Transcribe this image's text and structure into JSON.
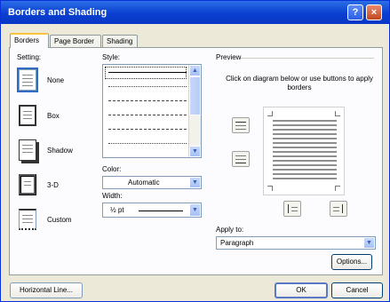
{
  "window": {
    "title": "Borders and Shading",
    "help_label": "?",
    "close_label": "×"
  },
  "tabs": [
    {
      "label": "Borders",
      "active": true
    },
    {
      "label": "Page Border",
      "active": false
    },
    {
      "label": "Shading",
      "active": false
    }
  ],
  "setting": {
    "label": "Setting:",
    "items": [
      {
        "label": "None",
        "selected": true
      },
      {
        "label": "Box",
        "selected": false
      },
      {
        "label": "Shadow",
        "selected": false
      },
      {
        "label": "3-D",
        "selected": false
      },
      {
        "label": "Custom",
        "selected": false
      }
    ]
  },
  "style": {
    "label": "Style:"
  },
  "color": {
    "label": "Color:",
    "value": "Automatic"
  },
  "width": {
    "label": "Width:",
    "value": "½ pt"
  },
  "preview": {
    "label": "Preview",
    "instructions": "Click on diagram below or use buttons to apply borders"
  },
  "apply_to": {
    "label": "Apply to:",
    "value": "Paragraph"
  },
  "buttons": {
    "options": "Options...",
    "horizontal_line": "Horizontal Line...",
    "ok": "OK",
    "cancel": "Cancel"
  },
  "colors": {
    "title_bar": "#0a3fd0",
    "dialog_bg": "#ece9d8",
    "tab_highlight": "#f7c43d"
  }
}
